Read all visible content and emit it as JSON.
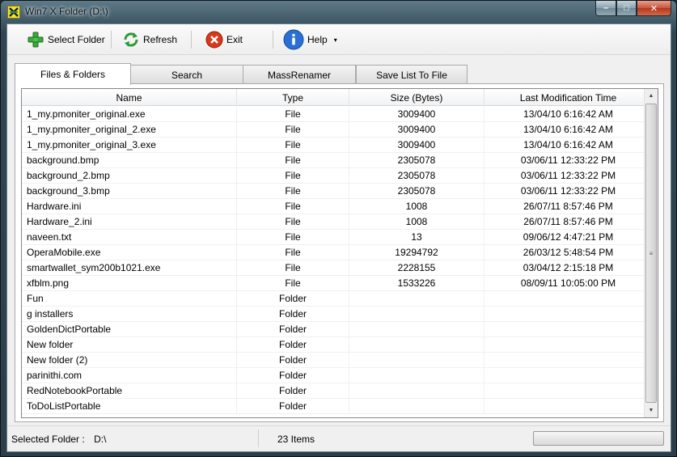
{
  "window": {
    "title": "Win7 X Folder (D:\\)",
    "min_symbol": "–",
    "max_symbol": "□",
    "close_symbol": "✕"
  },
  "toolbar": {
    "select_folder": "Select Folder",
    "refresh": "Refresh",
    "exit": "Exit",
    "help": "Help",
    "help_arrow": "▾"
  },
  "tabs": [
    "Files & Folders",
    "Search",
    "MassRenamer",
    "Save List To File"
  ],
  "table": {
    "columns": [
      "Name",
      "Type",
      "Size (Bytes)",
      "Last Modification Time"
    ],
    "rows": [
      [
        "1_my.pmoniter_original.exe",
        "File",
        "3009400",
        "13/04/10 6:16:42 AM"
      ],
      [
        "1_my.pmoniter_original_2.exe",
        "File",
        "3009400",
        "13/04/10 6:16:42 AM"
      ],
      [
        "1_my.pmoniter_original_3.exe",
        "File",
        "3009400",
        "13/04/10 6:16:42 AM"
      ],
      [
        "background.bmp",
        "File",
        "2305078",
        "03/06/11 12:33:22 PM"
      ],
      [
        "background_2.bmp",
        "File",
        "2305078",
        "03/06/11 12:33:22 PM"
      ],
      [
        "background_3.bmp",
        "File",
        "2305078",
        "03/06/11 12:33:22 PM"
      ],
      [
        "Hardware.ini",
        "File",
        "1008",
        "26/07/11 8:57:46 PM"
      ],
      [
        "Hardware_2.ini",
        "File",
        "1008",
        "26/07/11 8:57:46 PM"
      ],
      [
        "naveen.txt",
        "File",
        "13",
        "09/06/12 4:47:21 PM"
      ],
      [
        "OperaMobile.exe",
        "File",
        "19294792",
        "26/03/12 5:48:54 PM"
      ],
      [
        "smartwallet_sym200b1021.exe",
        "File",
        "2228155",
        "03/04/12 2:15:18 PM"
      ],
      [
        "xfblm.png",
        "File",
        "1533226",
        "08/09/11 10:05:00 PM"
      ],
      [
        "Fun",
        "Folder",
        "",
        ""
      ],
      [
        "g installers",
        "Folder",
        "",
        ""
      ],
      [
        "GoldenDictPortable",
        "Folder",
        "",
        ""
      ],
      [
        "New folder",
        "Folder",
        "",
        ""
      ],
      [
        "New folder (2)",
        "Folder",
        "",
        ""
      ],
      [
        "parinithi.com",
        "Folder",
        "",
        ""
      ],
      [
        "RedNotebookPortable",
        "Folder",
        "",
        ""
      ],
      [
        "ToDoListPortable",
        "Folder",
        "",
        ""
      ]
    ]
  },
  "scrollbar": {
    "up": "▲",
    "down": "▼",
    "grip": "≡"
  },
  "status": {
    "selected_folder_label": "Selected Folder :",
    "selected_folder_value": "D:\\",
    "item_count": "23 Items",
    "progress_percent": 0
  },
  "colors": {
    "progress_fill": "#37b24a"
  }
}
